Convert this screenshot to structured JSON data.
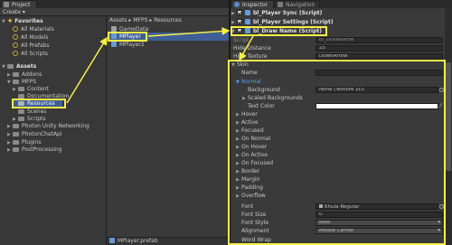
{
  "project_panel": {
    "tab_label": "Project",
    "create_label": "Create ▾",
    "favorites": {
      "label": "Favorites",
      "items": [
        "All Materials",
        "All Models",
        "All Prefabs",
        "All Scripts"
      ]
    },
    "assets": {
      "label": "Assets",
      "items": [
        "Addons",
        "MFPS",
        "Content",
        "Documentation",
        "Resources",
        "Scenes",
        "Scripts",
        "Photon Unity Networking",
        "PhotonChatApi",
        "Plugins",
        "PostProcessing"
      ]
    },
    "selected_item": "Resources",
    "breadcrumb": "Assets ▸ MFPS ▸ Resources",
    "files": [
      "GameData",
      "MPlayer",
      "MPlayer2"
    ],
    "selected_file": "MPlayer",
    "footer_file": "MPlayer.prefab"
  },
  "inspector_panel": {
    "tabs": [
      "Inspector",
      "Navigation"
    ],
    "components": [
      {
        "label": "bl_Player Sync (Script)"
      },
      {
        "label": "bl_Player Settings (Script)"
      },
      {
        "label": "bl_Draw Name (Script)"
      }
    ],
    "script_row": {
      "label": "Script",
      "value": "bl_DrawName"
    },
    "hide_distance": {
      "label": "Hide Distance",
      "value": "25"
    },
    "hide_texture": {
      "label": "Hide Texture",
      "value": "DownArrow"
    },
    "skin": {
      "label": "Skin",
      "name_label": "Name",
      "name_value": "",
      "normal_label": "Normal",
      "background_label": "Background",
      "background_value": "None (Texture 2D)",
      "scaled_backgrounds_label": "Scaled Backgrounds",
      "text_color_label": "Text Color",
      "text_color": "#ffffff",
      "states": [
        "Hover",
        "Active",
        "Focused",
        "On Normal",
        "On Hover",
        "On Active",
        "On Focused",
        "Border",
        "Margin",
        "Padding",
        "Overflow"
      ],
      "font_label": "Font",
      "font_value": "Khula-Regular",
      "font_size_label": "Font Size",
      "font_size_value": "0",
      "font_style_label": "Font Style",
      "font_style_value": "Bold",
      "alignment_label": "Alignment",
      "alignment_value": "Middle Center",
      "word_wrap_label": "Word Wrap"
    }
  },
  "annotation_color": "#f7ee4a"
}
